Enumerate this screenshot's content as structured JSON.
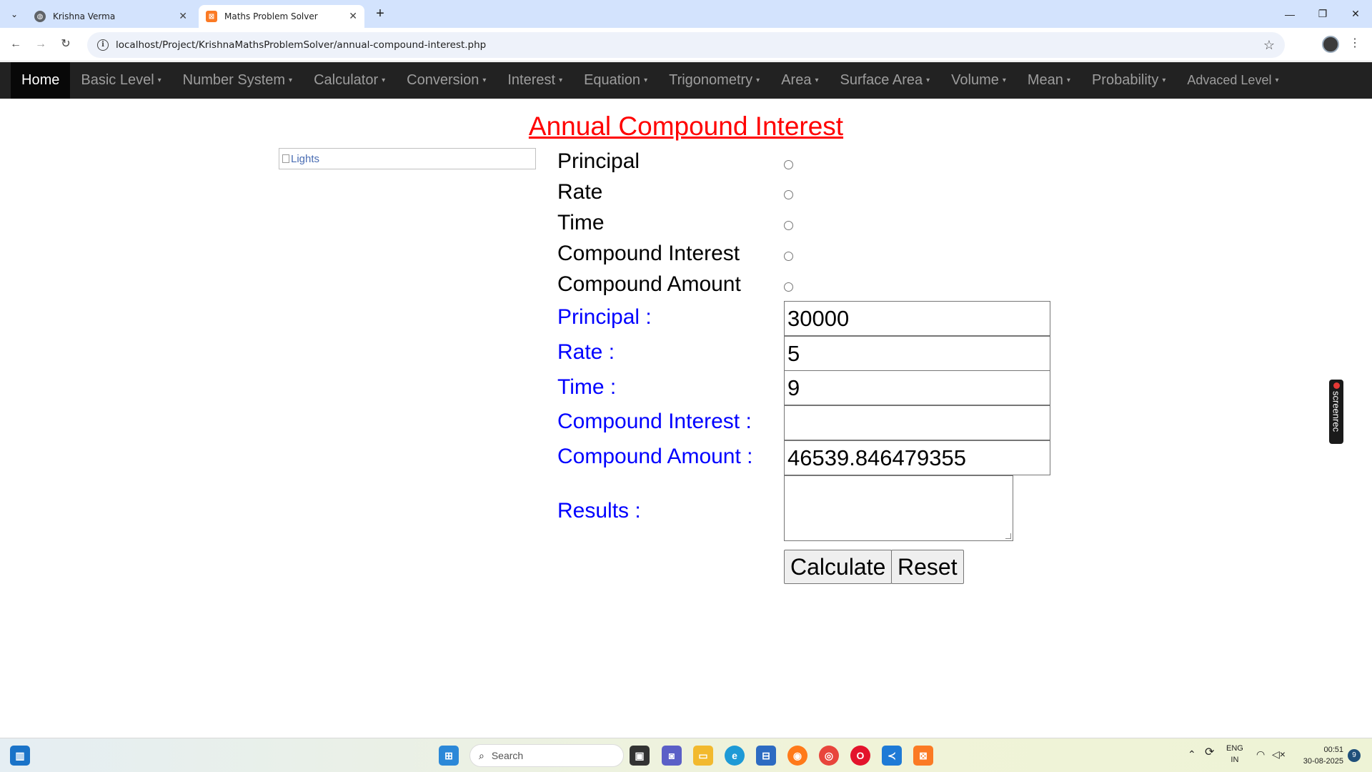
{
  "browser": {
    "tabs": [
      {
        "title": "Krishna Verma",
        "active": false
      },
      {
        "title": "Maths Problem Solver",
        "active": true
      }
    ],
    "url": "localhost/Project/KrishnaMathsProblemSolver/annual-compound-interest.php"
  },
  "nav": {
    "items": [
      {
        "label": "Home",
        "caret": ""
      },
      {
        "label": "Basic Level",
        "caret": "▾"
      },
      {
        "label": "Number System",
        "caret": "▾"
      },
      {
        "label": "Calculator",
        "caret": "▾"
      },
      {
        "label": "Conversion",
        "caret": "▾"
      },
      {
        "label": "Interest",
        "caret": "▾"
      },
      {
        "label": "Equation",
        "caret": "▾"
      },
      {
        "label": "Trigonometry",
        "caret": "▾"
      },
      {
        "label": "Area",
        "caret": "▾"
      },
      {
        "label": "Surface Area",
        "caret": "▾"
      },
      {
        "label": "Volume",
        "caret": "▾"
      },
      {
        "label": "Mean",
        "caret": "▾"
      },
      {
        "label": "Probability",
        "caret": "▾"
      },
      {
        "label": "Advaced Level",
        "caret": "▾"
      }
    ]
  },
  "page": {
    "title": "Annual Compound Interest",
    "image_alt": "Lights",
    "radio_options": [
      "Principal",
      "Rate",
      "Time",
      "Compound Interest",
      "Compound Amount"
    ],
    "fields": {
      "principal_label": "Principal :",
      "principal_value": "30000",
      "rate_label": "Rate :",
      "rate_value": "5",
      "time_label": "Time :",
      "time_value": "9",
      "ci_label": "Compound Interest :",
      "ci_value": "",
      "amount_label": "Compound Amount :",
      "amount_value": "46539.846479355",
      "results_label": "Results :",
      "results_value": ""
    },
    "buttons": {
      "calculate": "Calculate",
      "reset": "Reset"
    },
    "screenrec_label": "screenrec"
  },
  "taskbar": {
    "search_placeholder": "Search",
    "language": "ENG",
    "region": "IN",
    "time": "00:51",
    "date": "30-08-2025",
    "notification_count": "9"
  }
}
